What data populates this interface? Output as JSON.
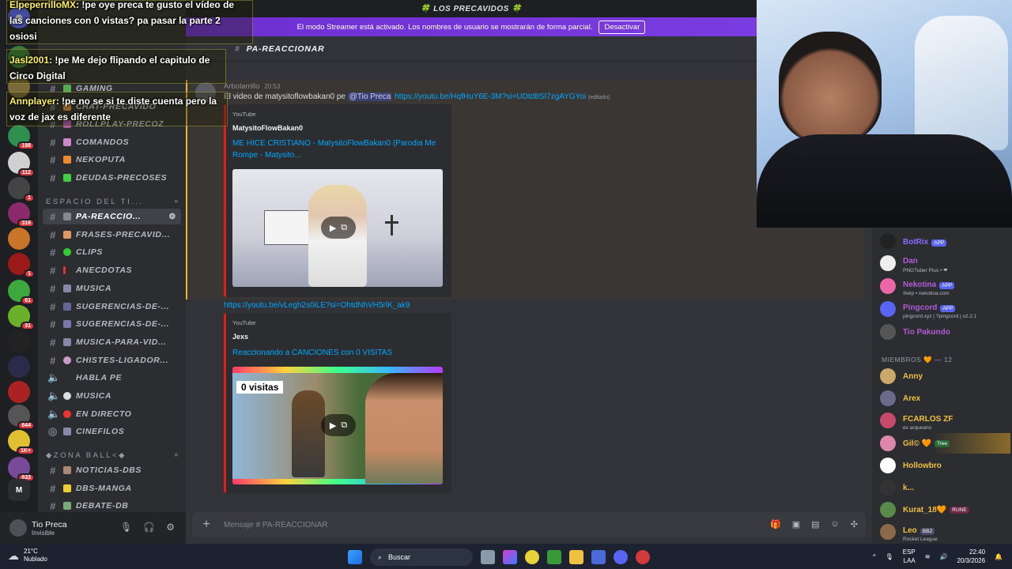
{
  "topbar": {
    "server_title": "🍀 LOS PRECAVIDOS 🍀"
  },
  "streamer_banner": {
    "text": "El modo Streamer está activado. Los nombres de usuario se mostrarán de forma parcial.",
    "button": "Desactivar"
  },
  "rail": {
    "badges": [
      "198",
      "112",
      "1",
      "316",
      "1",
      "61",
      "31",
      "644",
      "1K+",
      "633"
    ],
    "letter_server": "M"
  },
  "channels": {
    "items_top": [
      {
        "label": "GAMING"
      },
      {
        "label": "CHAT-PRECAVIDO"
      },
      {
        "label": "ROLLPLAY-PRECOZ"
      },
      {
        "label": "COMANDOS"
      },
      {
        "label": "NEKOPUTA"
      },
      {
        "label": "DEUDAS-PRECOSES"
      }
    ],
    "category_1": "ESPACIO DEL TI...",
    "items_mid": [
      {
        "label": "PA-REACCIO..."
      },
      {
        "label": "FRASES-PRECAVID..."
      },
      {
        "label": "CLIPS"
      },
      {
        "label": "ANECDOTAS"
      },
      {
        "label": "MUSICA"
      },
      {
        "label": "SUGERENCIAS-DE-..."
      },
      {
        "label": "SUGERENCIAS-DE-..."
      },
      {
        "label": "MUSICA-PARA-VID..."
      },
      {
        "label": "CHISTES-LIGADOR..."
      },
      {
        "label": "HABLA PE"
      },
      {
        "label": "MUSICA"
      },
      {
        "label": "EN DIRECTO"
      },
      {
        "label": "CINEFILOS"
      }
    ],
    "category_2": "◆ZONA BALL<◆",
    "items_bottom": [
      {
        "label": "NOTICIAS-DBS"
      },
      {
        "label": "DBS-MANGA"
      },
      {
        "label": "DEBATE-DB"
      }
    ]
  },
  "user_panel": {
    "name": "Tio Preca",
    "status": "Invisible"
  },
  "chat": {
    "channel_name": "PA-REACCIONAR",
    "message": {
      "author": "Arbolarrillo",
      "time": "20:53",
      "text_1": "El video de matysitoflowbakan0 pe",
      "mention": "@Tio Preca",
      "url": "https://youtu.be/HqfHuY6E-3M?si=UDtd8SI7zgAYGYoi",
      "edited": "(editado)"
    },
    "embed_1": {
      "provider": "YouTube",
      "author": "MatysitoFlowBakan0",
      "title": "ME HICE CRISTIANO - MatysitoFlowBakan0 (Parodia Me Rompe - Matysito..."
    },
    "link_2": "https://youtu.be/vLegh2s0iLE?si=OhtdNhVH5rlK_ak9",
    "embed_2": {
      "provider": "YouTube",
      "author": "Jexs",
      "title": "Reaccionando a CANCIONES con 0 VISITAS",
      "thumb_text": "0 visitas"
    },
    "composer_placeholder": "Mensaje #  PA-REACCIONAR"
  },
  "members": {
    "bots": [
      {
        "name": "BotRix",
        "tag": "APP",
        "sub": ""
      },
      {
        "name": "Dan",
        "tag": "",
        "sub": "PNGTuber Plus • ❤"
      },
      {
        "name": "Nekotina",
        "tag": "APP",
        "sub": "!help • nekotina.com"
      },
      {
        "name": "Pingcord",
        "tag": "APP",
        "sub": "pingcord.xyz | ?pingcord | v2.2.1"
      },
      {
        "name": "Tio Pakundo",
        "tag": "",
        "sub": ""
      }
    ],
    "header": "MIEMBROS 🧡 — 12",
    "list": [
      {
        "name": "Anny",
        "tag": "",
        "sub": ""
      },
      {
        "name": "Arex",
        "tag": "",
        "sub": ""
      },
      {
        "name": "FCARLOS ZF",
        "tag": "",
        "sub": "ex arqueano"
      },
      {
        "name": "Gil© 🧡",
        "tag": "Tree",
        "sub": ""
      },
      {
        "name": "Hollowbro",
        "tag": "",
        "sub": ""
      },
      {
        "name": "k...",
        "tag": "",
        "sub": ""
      },
      {
        "name": "Kurat_18🧡",
        "tag": "RUNE",
        "sub": ""
      },
      {
        "name": "Leo",
        "tag": "BBZ",
        "sub": "Rocket League"
      }
    ]
  },
  "overlay_chat": [
    {
      "name": "ElpeperrilloMX",
      "text": ": !pe oye preca te gusto el vídeo de las canciones con 0 vistas? pa pasar la parte 2 osiosi"
    },
    {
      "name": "Jasl2001",
      "text": ": !pe Me dejo flipando el capitulo de Circo Digital"
    },
    {
      "name": "Annplayer",
      "text": ": !pe no se si te diste cuenta pero la voz de jax es diferente"
    }
  ],
  "taskbar": {
    "temp": "21°C",
    "weather": "Nublado",
    "search": "Buscar",
    "lang": "ESP",
    "lang2": "LAA",
    "time": "22:40",
    "date": "20/3/2026"
  },
  "colors": {
    "accent": "#5865f2",
    "streamer_banner": "#7a3ce0",
    "highlight_border": "#f0b232",
    "link": "#00a8fc",
    "embed_border": "#e21b1b"
  }
}
